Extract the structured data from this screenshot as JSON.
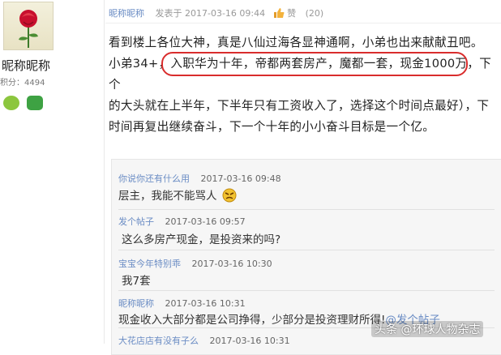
{
  "post": {
    "author": "昵称昵称",
    "posted_prefix": "发表于",
    "date": "2017-03-16 09:44",
    "like_label": "赞",
    "like_count": "(20)",
    "lines": [
      "看到楼上各位大神，真是八仙过海各显神通啊，小弟也出来献献丑吧。",
      "小弟34+，入职华为十年，帝都两套房产，魔都一套，现金1000万，下个",
      "的大头就在上半年，下半年只有工资收入了，选择这个时间点最好），下",
      "时间再复出继续奋斗，下一个十年的小小奋斗目标是一个亿。"
    ]
  },
  "user": {
    "name": "昵称昵称",
    "points": "积分：4494"
  },
  "replies": [
    {
      "author": "你说你还有什么用",
      "time": "2017-03-16 09:48",
      "text": "层主，我能不能骂人"
    },
    {
      "author": "发个帖子",
      "time": "2017-03-16 09:57",
      "text": "这么多房产现金，是投资来的吗?"
    },
    {
      "author": "宝宝今年特别乖",
      "time": "2017-03-16 10:30",
      "text": "我7套"
    },
    {
      "author": "昵称昵称",
      "time": "2017-03-16 10:31",
      "text": "现金收入大部分都是公司挣得，少部分是投资理财所得!",
      "mention": "@发个帖子"
    },
    {
      "author": "大花店店有没有子么",
      "time": "2017-03-16 10:31"
    }
  ],
  "watermark": "头条 @环球人物杂志",
  "colors": {
    "highlight": "#d92d2d",
    "link": "#6a8cc4"
  }
}
